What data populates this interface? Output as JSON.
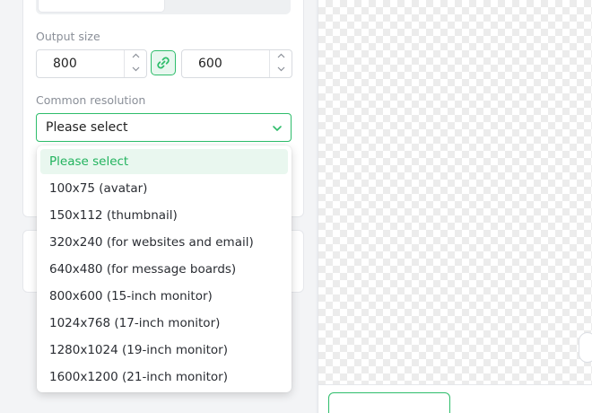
{
  "output_size": {
    "label": "Output size",
    "width": "800",
    "height": "600",
    "stepper_up": "⌃",
    "stepper_down": "⌄"
  },
  "common_resolution": {
    "label": "Common resolution",
    "selected": "Please select",
    "options": [
      "Please select",
      "100x75 (avatar)",
      "150x112 (thumbnail)",
      "320x240 (for websites and email)",
      "640x480 (for message boards)",
      "800x600 (15-inch monitor)",
      "1024x768 (17-inch monitor)",
      "1280x1024 (19-inch monitor)",
      "1600x1200 (21-inch monitor)"
    ]
  },
  "icons": {
    "link": "link-icon",
    "chevron": "chevron-down-icon"
  },
  "colors": {
    "accent": "#2ebd6b",
    "accent_light": "#e9f7ef",
    "selected_text": "#22b35e"
  }
}
